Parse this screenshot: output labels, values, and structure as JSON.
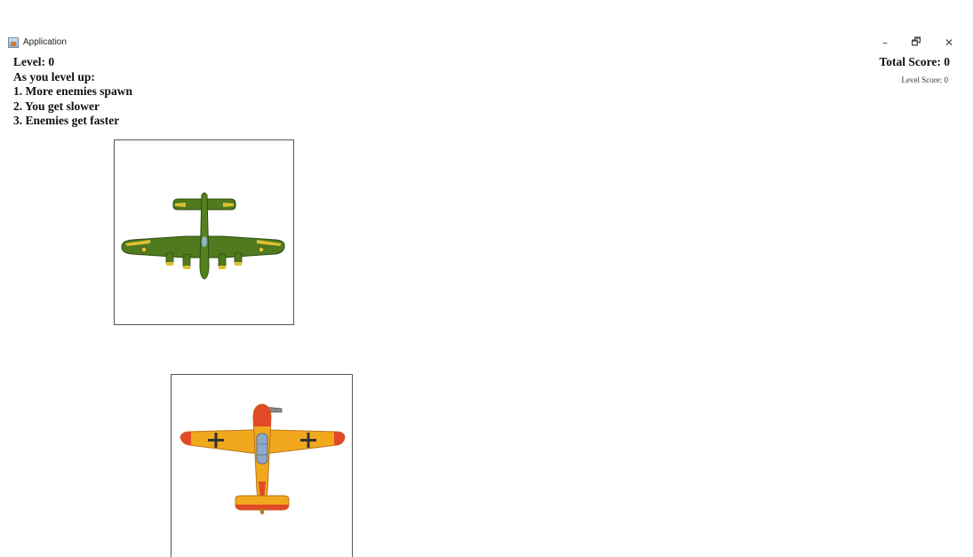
{
  "window": {
    "title": "Application",
    "minimize_glyph": "–",
    "maximize_glyph": "🗗",
    "close_glyph": "✕"
  },
  "hud": {
    "level": "Level: 0",
    "instructions_heading": "As you level up:",
    "instructions": [
      "1. More enemies spawn",
      "2. You get slower",
      "3. Enemies get faster"
    ],
    "total_score": "Total Score: 0",
    "level_score": "Level Score: 0"
  },
  "sprites": {
    "enemy": {
      "icon": "green-bomber-plane-icon",
      "colors": {
        "body": "#4f7a1e",
        "accent": "#e0c030"
      }
    },
    "player": {
      "icon": "orange-fighter-plane-icon",
      "colors": {
        "body": "#f2a81d",
        "accent": "#e04a26"
      }
    }
  }
}
